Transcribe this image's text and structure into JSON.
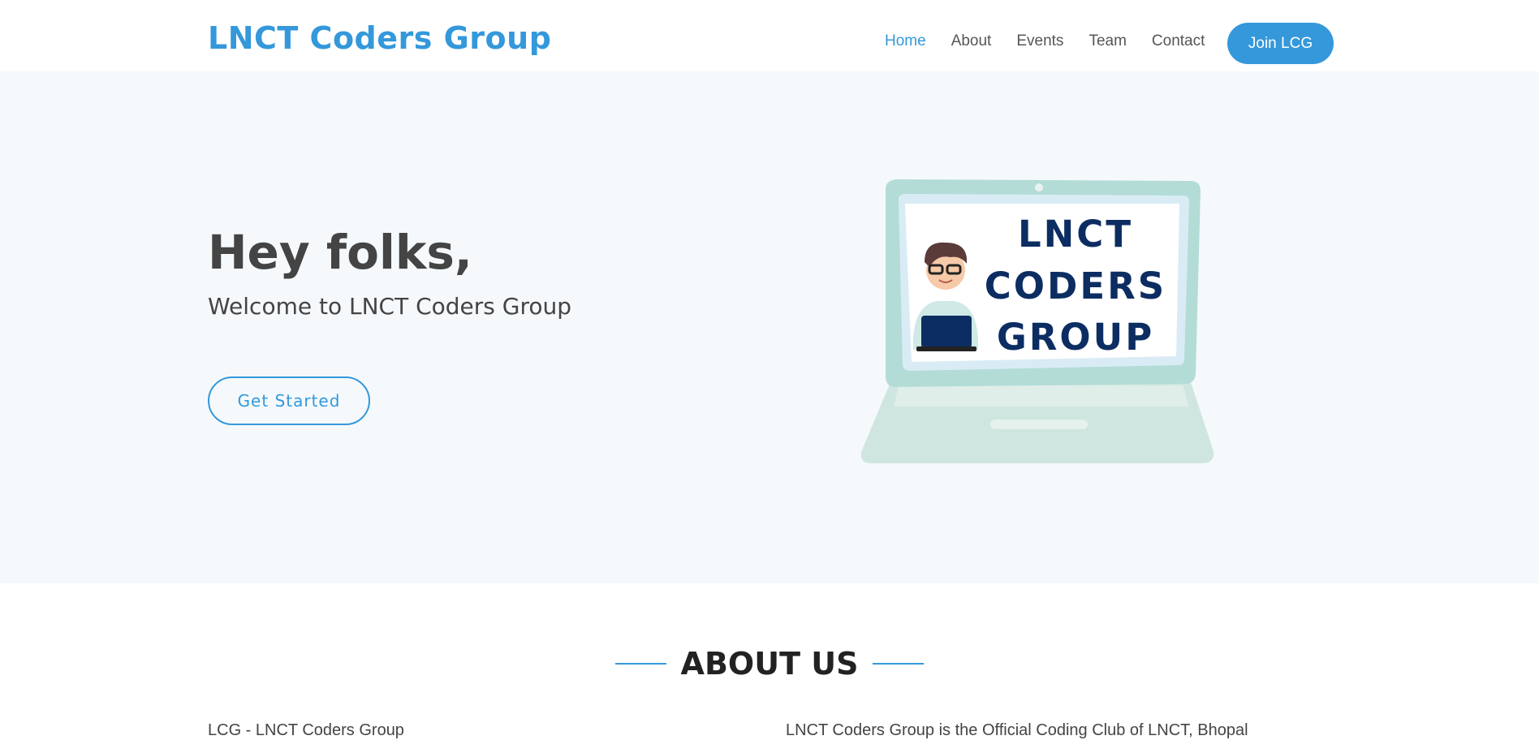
{
  "header": {
    "logo": "LNCT Coders Group",
    "nav": [
      "Home",
      "About",
      "Events",
      "Team",
      "Contact"
    ],
    "active_nav": "Home",
    "cta_label": "Join LCG"
  },
  "hero": {
    "title": "Hey folks,",
    "subtitle": "Welcome to LNCT Coders Group",
    "button_label": "Get Started",
    "illustration_text": [
      "LNCT",
      "CODERS",
      "GROUP"
    ]
  },
  "about": {
    "title": "ABOUT US",
    "col_left_text": "LCG - LNCT Coders Group",
    "col_right_text": "LNCT Coders Group is the Official Coding Club of LNCT, Bhopal"
  },
  "colors": {
    "accent": "#3498db",
    "hero_bg": "#f5f9fc",
    "text_dark": "#444444",
    "laptop_body": "#b3dcd7",
    "laptop_text": "#0c2d62"
  }
}
